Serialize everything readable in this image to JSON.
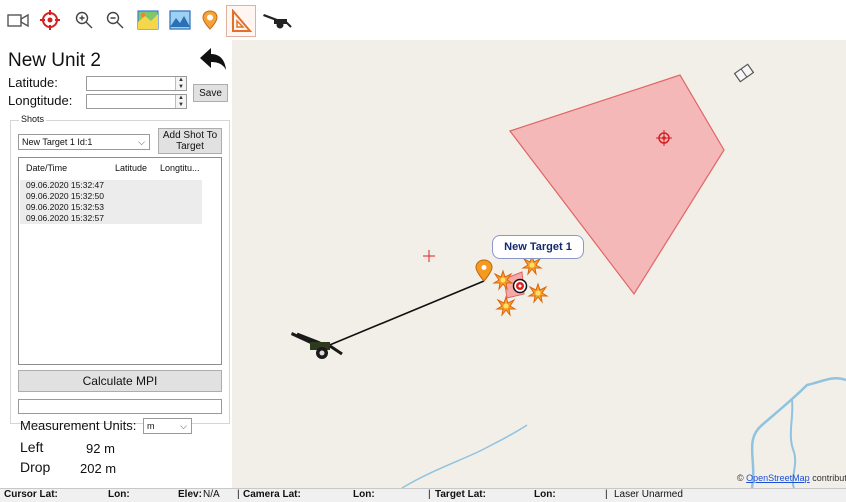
{
  "toolbar": {
    "tools": [
      "camera-icon",
      "target-crosshair-icon",
      "zoom-in-icon",
      "zoom-out-icon",
      "map-layer-icon",
      "elevation-map-icon",
      "marker-icon",
      "ruler-triangle-icon",
      "artillery-icon"
    ]
  },
  "panel": {
    "title": "New Unit 2",
    "latitude_label": "Latitude:",
    "longitude_label": "Longtitude:",
    "latitude_value": "",
    "longitude_value": "",
    "save_label": "Save",
    "shots_group_label": "Shots",
    "target_select_value": "New Target 1 Id:1",
    "add_shot_label": "Add Shot To Target",
    "shot_columns": [
      "Date/Time",
      "Latitude",
      "Longtitu..."
    ],
    "shots": [
      {
        "datetime": "09.06.2020 15:32:47"
      },
      {
        "datetime": "09.06.2020 15:32:50"
      },
      {
        "datetime": "09.06.2020 15:32:53"
      },
      {
        "datetime": "09.06.2020 15:32:57"
      }
    ],
    "calculate_label": "Calculate MPI",
    "mpi_result": "",
    "units_label": "Measurement Units:",
    "units_value": "m",
    "left_label": "Left",
    "left_value": "92 m",
    "drop_label": "Drop",
    "drop_value": "202 m"
  },
  "map": {
    "target_label": "New Target 1",
    "attribution_link": "OpenStreetMap",
    "attribution_suffix": "contributors",
    "zone_color": "#f4b8b8",
    "zone_stroke": "#e06666",
    "route_color": "#8fc3e0"
  },
  "status": {
    "cursor_lat_label": "Cursor Lat:",
    "cursor_lon_label": "Lon:",
    "elev_label": "Elev:",
    "elev_value": "N/A",
    "camera_lat_label": "Camera Lat:",
    "camera_lon_label": "Lon:",
    "target_lat_label": "Target Lat:",
    "target_lon_label": "Lon:",
    "laser_status": "Laser Unarmed"
  }
}
